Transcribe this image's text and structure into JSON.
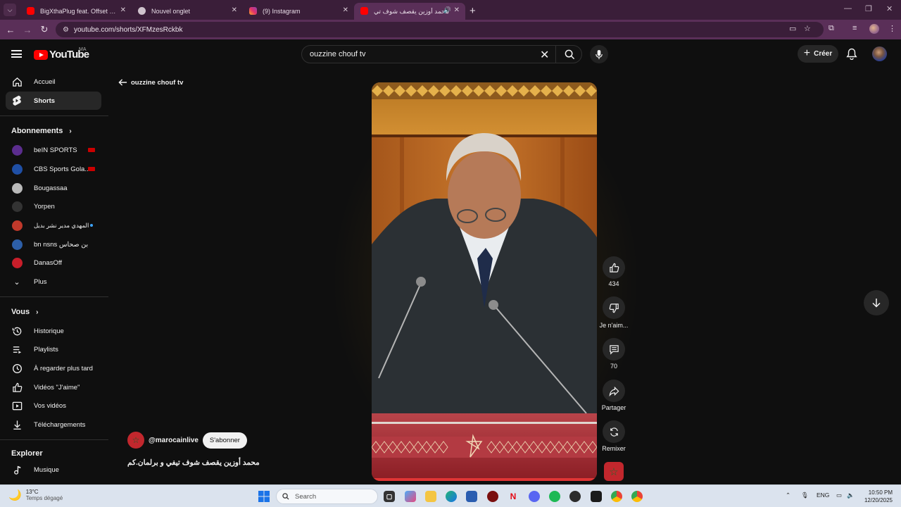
{
  "browser": {
    "tabs": [
      {
        "title": "BigXthaPlug feat. Offset - Clim...",
        "favicon_color": "#ff0000",
        "active": false
      },
      {
        "title": "Nouvel onglet",
        "favicon_color": "#cfc3cd",
        "active": false
      },
      {
        "title": "(9) Instagram",
        "favicon_color": "#e1306c",
        "active": false
      },
      {
        "title": "محمد أوزين يقصف شوف تي",
        "favicon_color": "#ff0000",
        "active": true
      }
    ],
    "url": "youtube.com/shorts/XFMzesRckbk"
  },
  "youtube": {
    "logo_text": "YouTube",
    "country_code": "MA",
    "search_value": "ouzzine chouf tv",
    "create_label": "Créer"
  },
  "sidebar": {
    "main": [
      {
        "label": "Accueil",
        "icon": "home-icon",
        "selected": false
      },
      {
        "label": "Shorts",
        "icon": "shorts-icon",
        "selected": true
      }
    ],
    "subs_header": "Abonnements",
    "subscriptions": [
      {
        "label": "beIN SPORTS",
        "color": "#5b2d8e",
        "badge": "live"
      },
      {
        "label": "CBS Sports Gola...",
        "color": "#1f4fa5",
        "badge": "live"
      },
      {
        "label": "Bougassaa",
        "color": "#b9b9b9",
        "badge": ""
      },
      {
        "label": "Yorpen",
        "color": "#333333",
        "badge": ""
      },
      {
        "label": "المهدي مدير نشر بديل",
        "color": "#c0392b",
        "badge": "dot"
      },
      {
        "label": "bn nsns بن صحاس",
        "color": "#2d5fa8",
        "badge": ""
      },
      {
        "label": "DanasOff",
        "color": "#c81e2a",
        "badge": ""
      }
    ],
    "more_label": "Plus",
    "you_header": "Vous",
    "you_items": [
      {
        "label": "Historique",
        "icon": "history-icon"
      },
      {
        "label": "Playlists",
        "icon": "playlists-icon"
      },
      {
        "label": "À regarder plus tard",
        "icon": "watch-later-icon"
      },
      {
        "label": "Vidéos \"J'aime\"",
        "icon": "liked-icon"
      },
      {
        "label": "Vos vidéos",
        "icon": "your-videos-icon"
      },
      {
        "label": "Téléchargements",
        "icon": "downloads-icon"
      }
    ],
    "explore_header": "Explorer",
    "explore_items": [
      {
        "label": "Musique",
        "icon": "music-icon"
      }
    ]
  },
  "shorts": {
    "back_label": "ouzzine chouf tv",
    "likes": "434",
    "dislike_label": "Je n'aim...",
    "comments": "70",
    "share_label": "Partager",
    "remix_label": "Remixer",
    "channel": "@marocainlive",
    "subscribe_label": "S'abonner",
    "video_title": "محمد أوزين يقصف شوف تيفي و برلمان.كم"
  },
  "taskbar": {
    "temp": "13°C",
    "weather": "Temps dégagé",
    "search_placeholder": "Search",
    "lang": "ENG",
    "time": "10:50 PM",
    "date": "12/20/2025"
  }
}
